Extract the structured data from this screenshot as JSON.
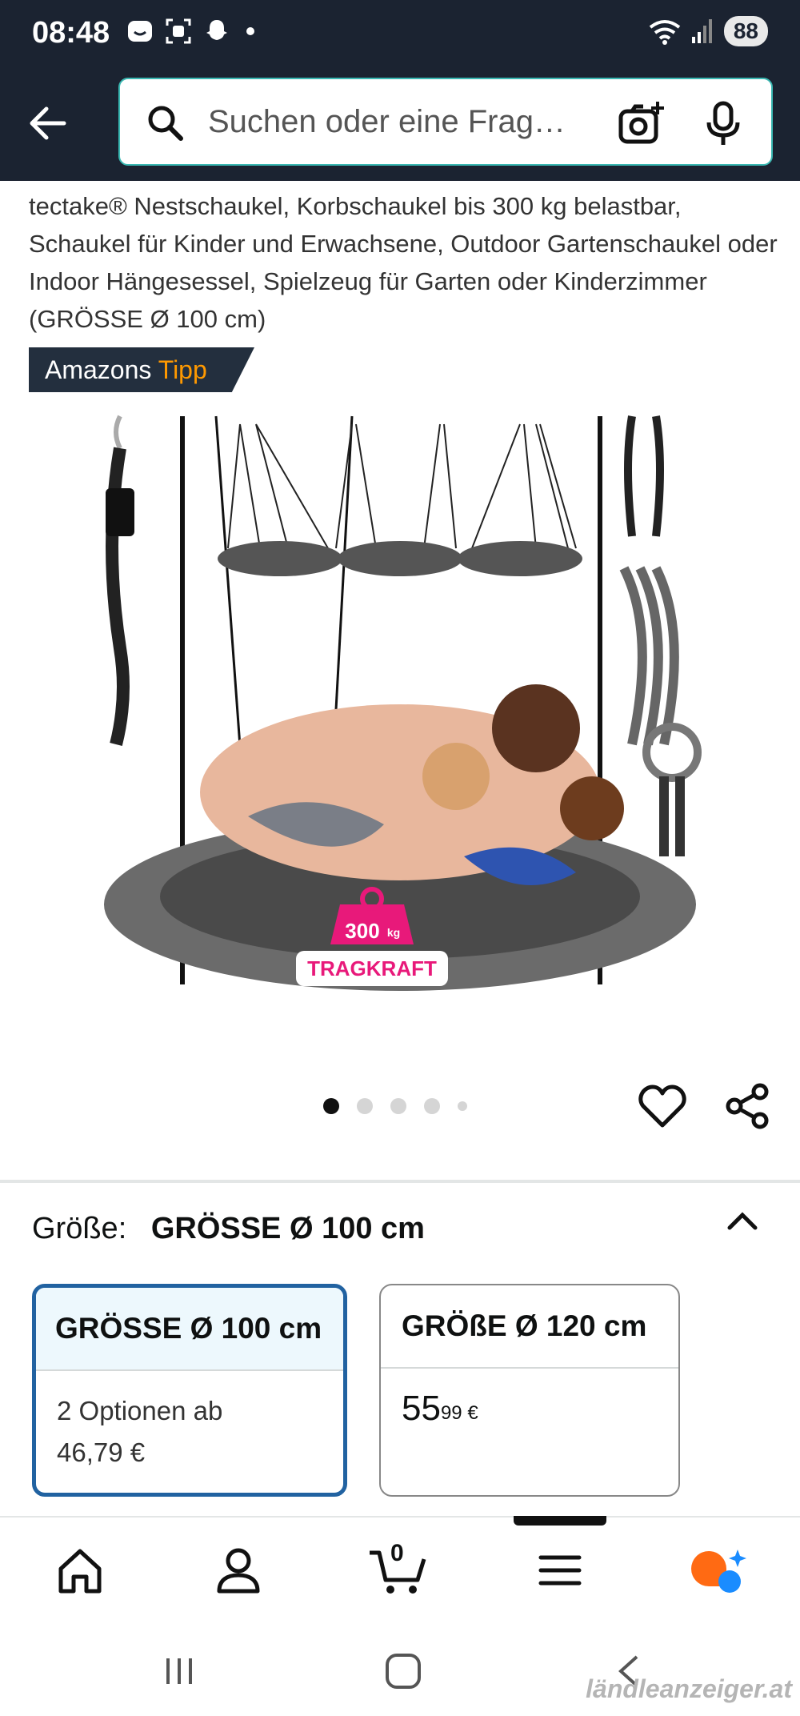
{
  "status_bar": {
    "time": "08:48",
    "battery": "88"
  },
  "search": {
    "placeholder": "Suchen oder eine Frag…"
  },
  "product": {
    "title": "tectake® Nestschaukel, Korbschaukel bis 300 kg belastbar, Schaukel für Kinder und Erwachsene, Outdoor Gartenschaukel oder Indoor Hängesessel, Spielzeug für Garten oder Kinderzimmer (GRÖSSE Ø 100 cm)",
    "badge_prefix": "Amazons",
    "badge_accent": "Tipp",
    "image_label_top": "300",
    "image_label_unit": "kg",
    "image_label_bottom": "TRAGKRAFT",
    "image_count": 5,
    "active_image": 1
  },
  "size": {
    "label": "Größe:",
    "selected": "GRÖSSE Ø 100 cm",
    "options": [
      {
        "name": "GRÖSSE Ø 100 cm",
        "line1": "2 Optionen ab",
        "line2": "46,79 €"
      },
      {
        "name": "GRÖßE Ø 120 cm",
        "price_whole": "55",
        "price_fraction": "99",
        "currency": "€"
      }
    ]
  },
  "nav": {
    "cart_count": "0"
  },
  "watermark": "ländleanzeiger.at",
  "colors": {
    "header": "#1b2331",
    "selected_border": "#2162a1",
    "accent": "#ff9900",
    "tag": "#e8197a"
  }
}
